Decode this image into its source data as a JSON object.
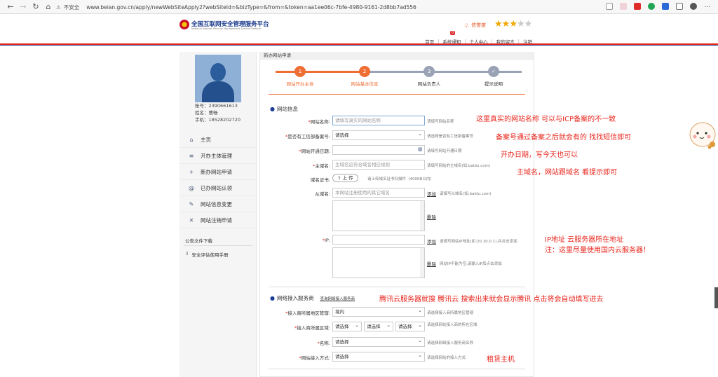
{
  "browser": {
    "insecure_label": "不安全",
    "url": "www.beian.gov.cn/apply/newWebSiteApply2?webSiteId=&bizType=&from=&token=aa1ee06c-7bfe-4980-9161-2d8bb7ad556"
  },
  "header": {
    "title": "全国互联网安全管理服务平台",
    "subtitle": "National Internet Security Management Service Platform",
    "credit_label": "信誉度",
    "stars_on": 3,
    "stars_total": 5,
    "nav": [
      "首页",
      "系统通知",
      "个人中心",
      "我的留言",
      "注销"
    ],
    "notify_badge": "0"
  },
  "sidebar": {
    "user": {
      "account": "账号：2390661613",
      "name": "姓名：曹畅",
      "phone": "手机：18528202720"
    },
    "menu": [
      {
        "icon": "home-icon",
        "label": "主页"
      },
      {
        "icon": "list-icon",
        "label": "开办主体管理"
      },
      {
        "icon": "plus-icon",
        "label": "新办网站申请"
      },
      {
        "icon": "at-icon",
        "label": "已办网站认领"
      },
      {
        "icon": "edit-icon",
        "label": "网站信息变更"
      },
      {
        "icon": "close-icon",
        "label": "网站注销申请"
      }
    ],
    "notice_title": "公告文件下载",
    "notice_item": "安全评估使用手册"
  },
  "main": {
    "title": "新办网站申请",
    "steps": [
      {
        "num": "1",
        "label": "网站开办主体"
      },
      {
        "num": "2",
        "label": "网站基本信息"
      },
      {
        "num": "3",
        "label": "网站负责人"
      },
      {
        "num": "✓",
        "label": "提示说明"
      }
    ],
    "site_section": "网站信息",
    "fields": {
      "site_name": {
        "label": "网站名称:",
        "placeholder": "请填写真实的网站名称",
        "hint": "请填写网站名称"
      },
      "icp": {
        "label": "是否有工信部备案号:",
        "value": "请选择",
        "hint": "请选择是否有工信部备案号"
      },
      "open_date": {
        "label": "网站开通日期:",
        "hint": "请填写网站开通日期"
      },
      "domain": {
        "label": "主域名:",
        "placeholder": "主域名应符合域名相应规则",
        "hint": "请填写网站的主域名(如:baidu.com)"
      },
      "cert": {
        "label": "域名证书:",
        "button": "上 传",
        "hint": "请上传域名证书扫描件（400KB以内）"
      },
      "sub_domain": {
        "label": "从域名:",
        "placeholder": "本网站注册使用的其它域名",
        "add": "添加",
        "hint": "请填写从域名(如:baidu.com)",
        "del": "删除"
      },
      "ip": {
        "label": "IP:",
        "add": "添加",
        "hint": "请填写网站IP地址(如:20.10.0.1),并点击添加",
        "del": "删除",
        "del_hint": "网站IP不能为空,请输入IP后点击添加"
      }
    },
    "isp_section": "网络接入服务商",
    "isp_link": "查询网络接入服务商",
    "isp_fields": {
      "region": {
        "label": "接入商所属地区管辖:",
        "value": "境内",
        "hint": "请选择接入商所属地区管辖"
      },
      "area": {
        "label": "接入商所属区域:",
        "v1": "请选择",
        "v2": "请选择",
        "v3": "请选择",
        "hint": "请选择网站接入商的所在区域"
      },
      "name": {
        "label": "名称:",
        "value": "请选择",
        "hint": "请选择网络接入服务商名称"
      },
      "method": {
        "label": "网站接入方式:",
        "value": "请选择",
        "hint": "请选择网站的接入方式"
      }
    }
  },
  "annotations": {
    "a1": "这里真实的网站名称 可以与ICP备案的不一致",
    "a2": "备案号通过备案之后就会有的  找找短信即可",
    "a3": "开办日期，写今天也可以",
    "a4": "主域名，网站跟域名 看提示即可",
    "a5": "IP地址 云服务器所在地址",
    "a6": "注：这里尽量使用国内云服务器！",
    "a7": "腾讯云服务器就搜 腾讯云 搜索出来就会显示腾讯 点击将会自动填写进去",
    "a8": "租赁主机"
  },
  "colors": {
    "accent": "#ef6e34",
    "brand_blue": "#1c3f95",
    "annotation": "#e8261d"
  }
}
